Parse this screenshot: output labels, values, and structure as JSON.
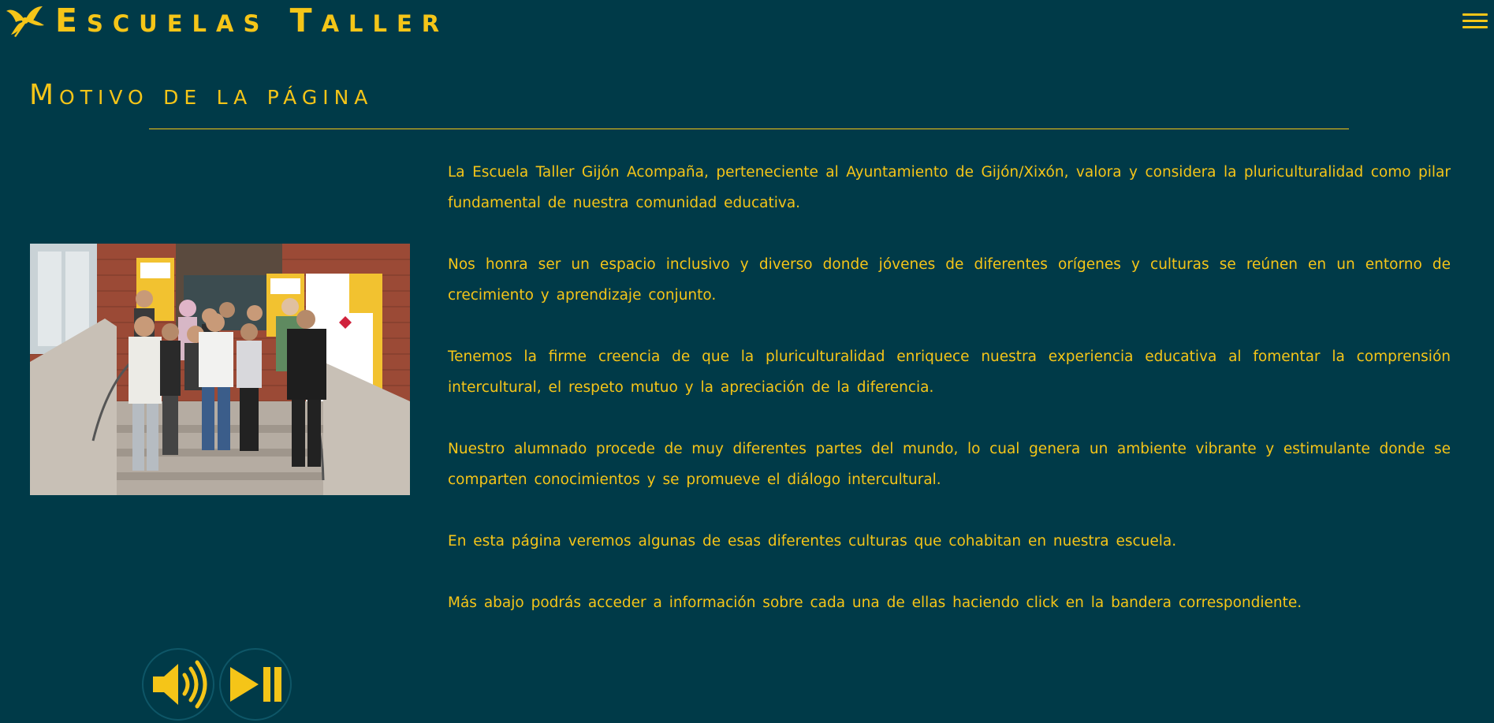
{
  "header": {
    "site_title": "Escuelas Taller",
    "logo_icon": "leaf-logo-icon",
    "menu_icon": "hamburger-menu-icon"
  },
  "section": {
    "title": "Motivo de la página"
  },
  "photo": {
    "alt": "Grupo de alumnos frente a la Escuela Taller Gijón Acompaña"
  },
  "paragraphs": [
    "La Escuela Taller Gijón Acompaña, perteneciente al Ayuntamiento de Gijón/Xixón, valora y considera la pluriculturalidad como pilar fundamental de nuestra comunidad educativa.",
    "Nos honra ser un espacio inclusivo y diverso donde jóvenes de diferentes orígenes y culturas se reúnen en un entorno de crecimiento y aprendizaje conjunto.",
    "Tenemos la firme creencia de que la pluriculturalidad enriquece nuestra experiencia educativa al fomentar la comprensión intercultural, el respeto mutuo y la apreciación de la diferencia.",
    "Nuestro alumnado procede de muy diferentes partes del mundo, lo cual genera un ambiente vibrante y estimulante donde se comparten conocimientos y se promueve el diálogo intercultural.",
    "En esta página veremos algunas de esas diferentes culturas que cohabitan en nuestra escuela.",
    "Más abajo podrás acceder a información sobre cada una de ellas haciendo click en la bandera correspondiente."
  ],
  "audio": {
    "sound_icon": "speaker-volume-icon",
    "play_icon": "play-pause-icon"
  },
  "colors": {
    "background": "#003a48",
    "accent": "#f5c518"
  }
}
